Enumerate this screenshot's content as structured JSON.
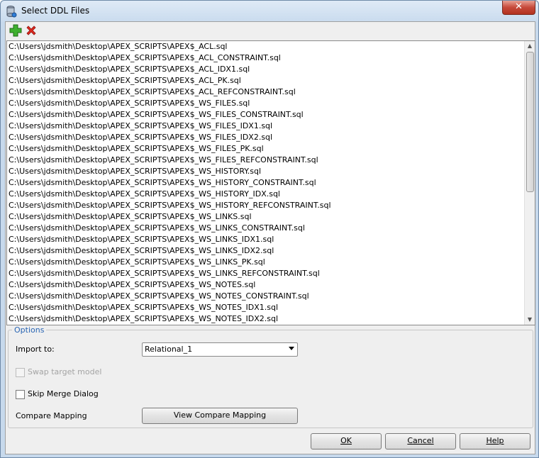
{
  "window": {
    "title": "Select DDL Files",
    "close_label": "✕"
  },
  "toolbar": {
    "add_icon": "add-icon",
    "remove_icon": "remove-icon"
  },
  "files": [
    "C:\\Users\\jdsmith\\Desktop\\APEX_SCRIPTS\\APEX$_ACL.sql",
    "C:\\Users\\jdsmith\\Desktop\\APEX_SCRIPTS\\APEX$_ACL_CONSTRAINT.sql",
    "C:\\Users\\jdsmith\\Desktop\\APEX_SCRIPTS\\APEX$_ACL_IDX1.sql",
    "C:\\Users\\jdsmith\\Desktop\\APEX_SCRIPTS\\APEX$_ACL_PK.sql",
    "C:\\Users\\jdsmith\\Desktop\\APEX_SCRIPTS\\APEX$_ACL_REFCONSTRAINT.sql",
    "C:\\Users\\jdsmith\\Desktop\\APEX_SCRIPTS\\APEX$_WS_FILES.sql",
    "C:\\Users\\jdsmith\\Desktop\\APEX_SCRIPTS\\APEX$_WS_FILES_CONSTRAINT.sql",
    "C:\\Users\\jdsmith\\Desktop\\APEX_SCRIPTS\\APEX$_WS_FILES_IDX1.sql",
    "C:\\Users\\jdsmith\\Desktop\\APEX_SCRIPTS\\APEX$_WS_FILES_IDX2.sql",
    "C:\\Users\\jdsmith\\Desktop\\APEX_SCRIPTS\\APEX$_WS_FILES_PK.sql",
    "C:\\Users\\jdsmith\\Desktop\\APEX_SCRIPTS\\APEX$_WS_FILES_REFCONSTRAINT.sql",
    "C:\\Users\\jdsmith\\Desktop\\APEX_SCRIPTS\\APEX$_WS_HISTORY.sql",
    "C:\\Users\\jdsmith\\Desktop\\APEX_SCRIPTS\\APEX$_WS_HISTORY_CONSTRAINT.sql",
    "C:\\Users\\jdsmith\\Desktop\\APEX_SCRIPTS\\APEX$_WS_HISTORY_IDX.sql",
    "C:\\Users\\jdsmith\\Desktop\\APEX_SCRIPTS\\APEX$_WS_HISTORY_REFCONSTRAINT.sql",
    "C:\\Users\\jdsmith\\Desktop\\APEX_SCRIPTS\\APEX$_WS_LINKS.sql",
    "C:\\Users\\jdsmith\\Desktop\\APEX_SCRIPTS\\APEX$_WS_LINKS_CONSTRAINT.sql",
    "C:\\Users\\jdsmith\\Desktop\\APEX_SCRIPTS\\APEX$_WS_LINKS_IDX1.sql",
    "C:\\Users\\jdsmith\\Desktop\\APEX_SCRIPTS\\APEX$_WS_LINKS_IDX2.sql",
    "C:\\Users\\jdsmith\\Desktop\\APEX_SCRIPTS\\APEX$_WS_LINKS_PK.sql",
    "C:\\Users\\jdsmith\\Desktop\\APEX_SCRIPTS\\APEX$_WS_LINKS_REFCONSTRAINT.sql",
    "C:\\Users\\jdsmith\\Desktop\\APEX_SCRIPTS\\APEX$_WS_NOTES.sql",
    "C:\\Users\\jdsmith\\Desktop\\APEX_SCRIPTS\\APEX$_WS_NOTES_CONSTRAINT.sql",
    "C:\\Users\\jdsmith\\Desktop\\APEX_SCRIPTS\\APEX$_WS_NOTES_IDX1.sql",
    "C:\\Users\\jdsmith\\Desktop\\APEX_SCRIPTS\\APEX$_WS_NOTES_IDX2.sql"
  ],
  "options": {
    "legend": "Options",
    "import_to_label": "Import to:",
    "import_to_value": "Relational_1",
    "swap_target_label": "Swap target model",
    "swap_target_checked": false,
    "skip_merge_label": "Skip Merge Dialog",
    "skip_merge_checked": false,
    "compare_mapping_label": "Compare Mapping",
    "view_compare_button": "View Compare Mapping"
  },
  "buttons": {
    "ok": "OK",
    "cancel": "Cancel",
    "help": "Help"
  },
  "colors": {
    "options_legend": "#2a66b4",
    "add_icon": "#2a9a1e",
    "remove_icon": "#d0201a"
  }
}
